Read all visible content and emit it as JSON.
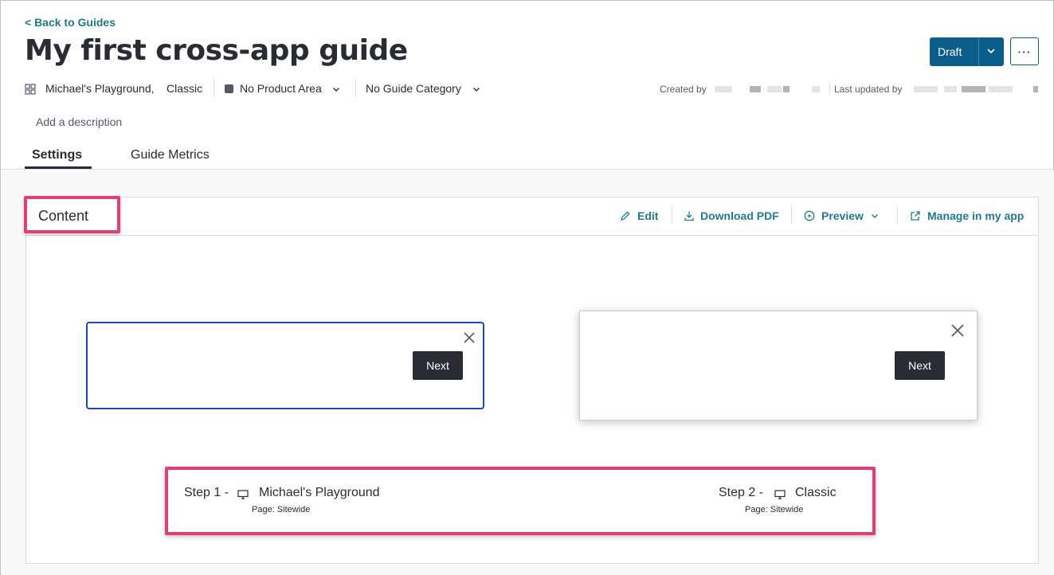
{
  "nav": {
    "back_link": "< Back to Guides"
  },
  "page": {
    "title": "My first cross-app guide"
  },
  "actions": {
    "status_label": "Draft",
    "more_label": "···"
  },
  "meta": {
    "app_1": "Michael's Playground,",
    "app_2": "Classic",
    "product_area": "No Product Area",
    "guide_category": "No Guide Category",
    "created_by_label": "Created by",
    "updated_by_label": "Last updated by"
  },
  "description": {
    "placeholder": "Add a description"
  },
  "tabs": [
    {
      "label": "Settings",
      "active": true
    },
    {
      "label": "Guide Metrics",
      "active": false
    }
  ],
  "content_card": {
    "title": "Content",
    "edit_label": "Edit",
    "download_label": "Download PDF",
    "preview_label": "Preview",
    "manage_label": "Manage in my app"
  },
  "guide_previews": [
    {
      "next_label": "Next"
    },
    {
      "next_label": "Next"
    }
  ],
  "steps": [
    {
      "label": "Step 1 -",
      "app": "Michael's Playground",
      "page": "Page: Sitewide"
    },
    {
      "label": "Step 2 -",
      "app": "Classic",
      "page": "Page: Sitewide"
    }
  ],
  "colors": {
    "accent": "#1f7a8c",
    "primary_button": "#0b5d8c",
    "highlight": "#e0406f",
    "guide_border": "#1b4aa8"
  }
}
